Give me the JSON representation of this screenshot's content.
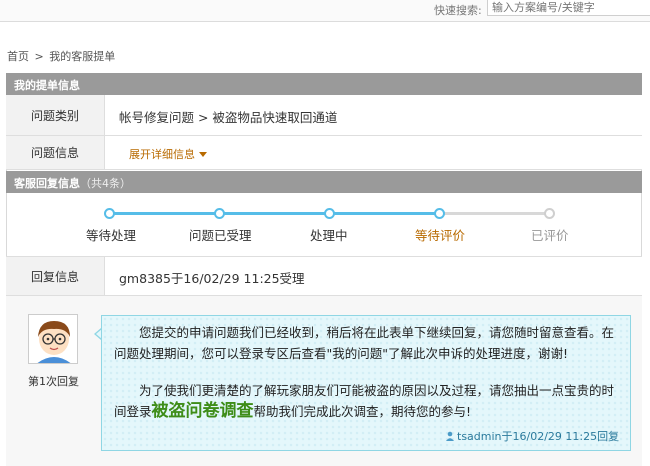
{
  "search": {
    "label": "快速搜索:",
    "placeholder": "输入方案编号/关键字"
  },
  "breadcrumb": {
    "home": "首页",
    "sep": ">",
    "current": "我的客服提单"
  },
  "ticket_info": {
    "heading": "我的提单信息",
    "category_label": "问题类别",
    "category_value": "帐号修复问题 > 被盗物品快速取回通道",
    "info_label": "问题信息",
    "expand_label": "展开详细信息"
  },
  "reply_section": {
    "heading": "客服回复信息",
    "count": "（共4条）"
  },
  "progress": {
    "steps": [
      "等待处理",
      "问题已受理",
      "处理中",
      "等待评价",
      "已评价"
    ],
    "current_index": 3
  },
  "reply_info": {
    "label": "回复信息",
    "value": "gm8385于16/02/29 11:25受理"
  },
  "reply": {
    "count_label": "第1次回复",
    "para1": "您提交的申请问题我们已经收到，稍后将在此表单下继续回复，请您随时留意查看。在问题处理期间，您可以登录专区后查看\"我的问题\"了解此次申诉的处理进度，谢谢!",
    "para2_pre": "为了使我们更清楚的了解玩家朋友们可能被盗的原因以及过程，请您抽出一点宝贵的时间登录",
    "link_text": "被盗问卷调查",
    "para2_post": "帮助我们完成此次调查，期待您的参与!",
    "signature": "tsadmin于16/02/29 11:25回复"
  },
  "colors": {
    "accent": "#56bde8",
    "current_step": "#b86a00",
    "link_green": "#3e8d18",
    "header_gray": "#9a9a9a"
  }
}
